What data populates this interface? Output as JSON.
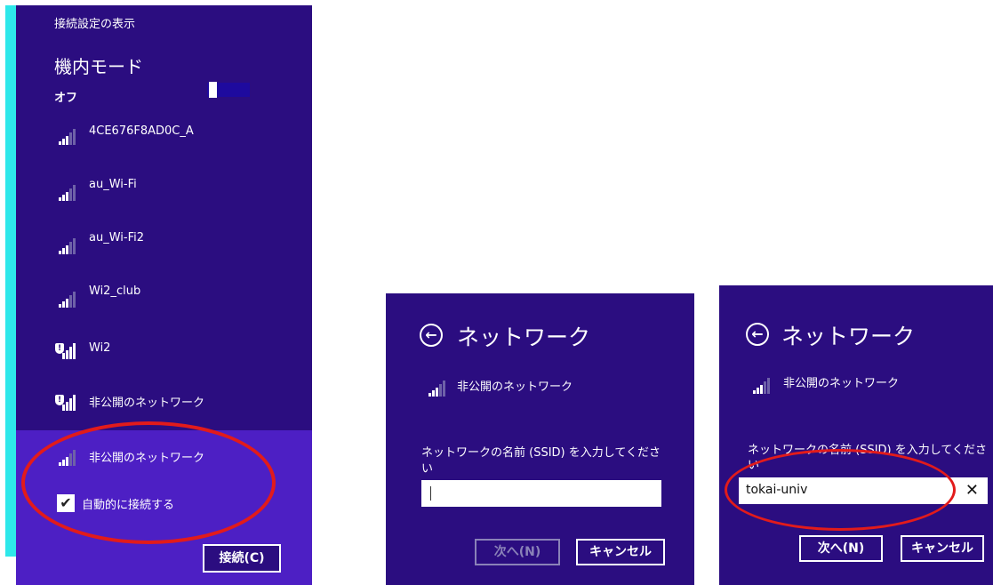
{
  "panel1": {
    "header": "接続設定の表示",
    "airplane_title": "機内モード",
    "airplane_state": "オフ",
    "networks": [
      {
        "name": "4CE676F8AD0C_A",
        "secured": false
      },
      {
        "name": "au_Wi-Fi",
        "secured": false
      },
      {
        "name": "au_Wi-Fi2",
        "secured": false
      },
      {
        "name": "Wi2_club",
        "secured": false
      },
      {
        "name": "Wi2",
        "secured": true
      },
      {
        "name": "非公開のネットワーク",
        "secured": true
      }
    ],
    "selected_network": "非公開のネットワーク",
    "auto_connect_label": "自動的に接続する",
    "auto_connect_checked": "✔",
    "connect_label": "接続(C)",
    "shield_symbol": "!"
  },
  "panel2": {
    "back_symbol": "←",
    "title": "ネットワーク",
    "network_name": "非公開のネットワーク",
    "prompt_line1": "ネットワークの名前 (SSID) を入力してくださ",
    "prompt_line2": "い",
    "input_value": "",
    "next_label": "次へ(N)",
    "cancel_label": "キャンセル"
  },
  "panel3": {
    "back_symbol": "←",
    "title": "ネットワーク",
    "network_name": "非公開のネットワーク",
    "prompt_line1": "ネットワークの名前 (SSID) を入力してくださ",
    "prompt_line2": "い",
    "input_value": "tokai-univ",
    "clear_symbol": "✕",
    "next_label": "次へ(N)",
    "cancel_label": "キャンセル"
  },
  "colors": {
    "panel_bg": "#2b0d80",
    "selected_bg": "#4d1fc4",
    "accent_edge": "#2ee8ea",
    "highlight_ellipse": "#e21b1b"
  }
}
